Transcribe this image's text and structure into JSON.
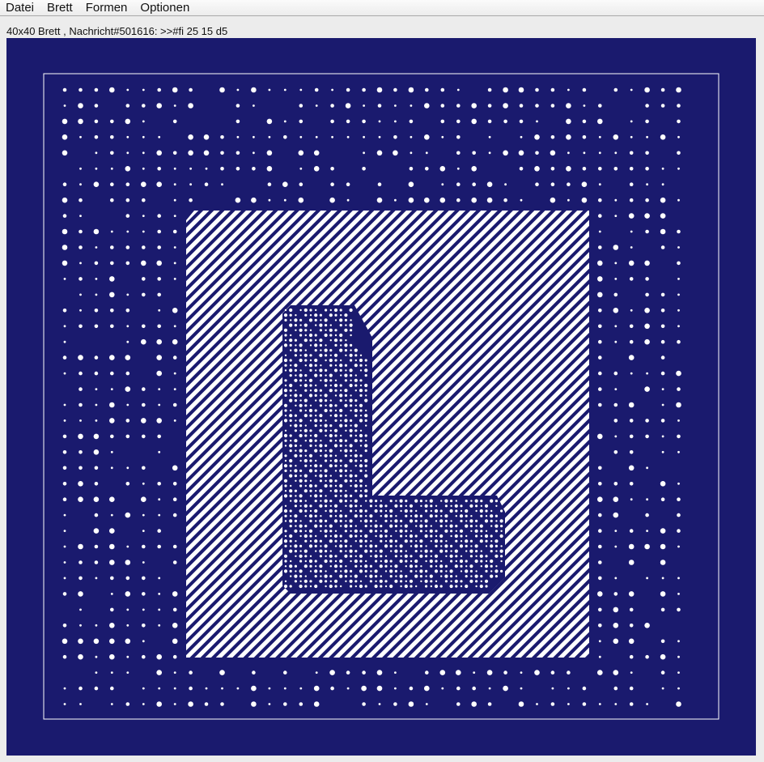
{
  "menubar": {
    "items": [
      "Datei",
      "Brett",
      "Formen",
      "Optionen"
    ]
  },
  "status": {
    "text": "40x40 Brett , Nachricht#501616: >>#fi 25 15 d5"
  },
  "board": {
    "rows": 40,
    "cols": 40,
    "background_color": "#1a1a6e",
    "foreground_color": "#ffffff",
    "outer_zone": "scattered-dots",
    "middle_zone": "diagonal-stripes",
    "inner_shape": "L-shape-lattice"
  }
}
